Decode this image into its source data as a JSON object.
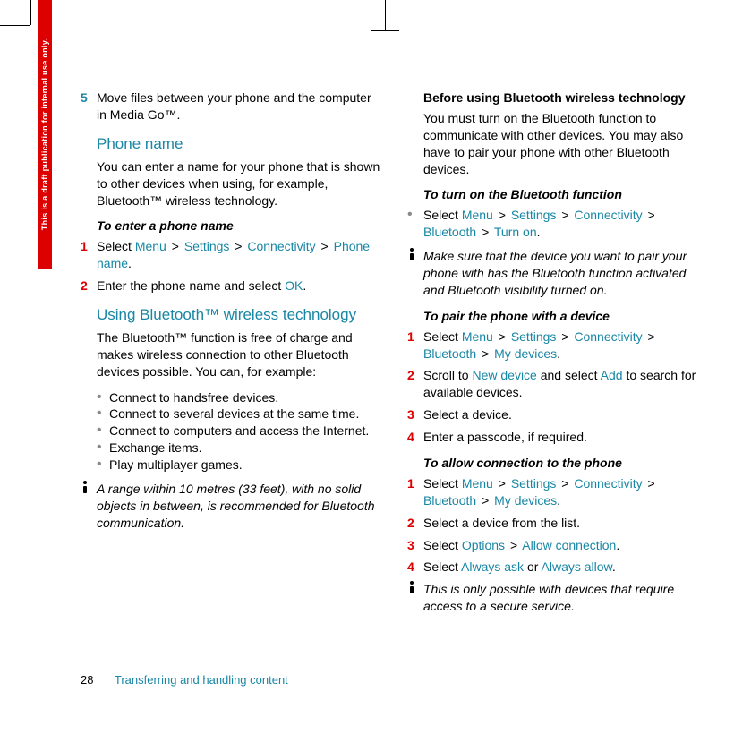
{
  "side_label": "This is a draft publication for internal use only.",
  "col1": {
    "step5_num": "5",
    "step5_text": "Move files between your phone and the computer in Media Go™.",
    "h_phone_name": "Phone name",
    "p_phone_name": "You can enter a name for your phone that is shown to other devices when using, for example, Bluetooth™ wireless technology.",
    "h_enter_name": "To enter a phone name",
    "enter_s1_num": "1",
    "enter_s1_pre": "Select ",
    "enter_s1_menu": "Menu",
    "enter_s1_settings": "Settings",
    "enter_s1_conn": "Connectivity",
    "enter_s1_phone_name": "Phone name",
    "enter_s2_num": "2",
    "enter_s2_pre": "Enter the phone name and select ",
    "enter_s2_ok": "OK",
    "h_bt": "Using Bluetooth™ wireless technology",
    "p_bt": "The Bluetooth™ function is free of charge and makes wireless connection to other Bluetooth devices possible. You can, for example:",
    "b1": "Connect to handsfree devices.",
    "b2": "Connect to several devices at the same time.",
    "b3": "Connect to computers and access the Internet.",
    "b4": "Exchange items.",
    "b5": "Play multiplayer games.",
    "note1": "A range within 10 metres (33 feet), with no solid objects in between, is recommended for Bluetooth communication."
  },
  "col2": {
    "h_before": "Before using Bluetooth wireless technology",
    "p_before": "You must turn on the Bluetooth function to communicate with other devices. You may also have to pair your phone with other Bluetooth devices.",
    "h_turn_on": "To turn on the Bluetooth function",
    "turn_pre": "Select ",
    "turn_menu": "Menu",
    "turn_settings": "Settings",
    "turn_conn": "Connectivity",
    "turn_bt": "Bluetooth",
    "turn_on": "Turn on",
    "note2": "Make sure that the device you want to pair your phone with has the Bluetooth function activated and Bluetooth visibility turned on.",
    "h_pair": "To pair the phone with a device",
    "pair1_num": "1",
    "pair1_pre": "Select ",
    "pair1_menu": "Menu",
    "pair1_settings": "Settings",
    "pair1_conn": "Connectivity",
    "pair1_bt": "Bluetooth",
    "pair1_my": "My devices",
    "pair2_num": "2",
    "pair2_a": "Scroll to ",
    "pair2_new": "New device",
    "pair2_b": " and select ",
    "pair2_add": "Add",
    "pair2_c": " to search for available devices.",
    "pair3_num": "3",
    "pair3": "Select a device.",
    "pair4_num": "4",
    "pair4": "Enter a passcode, if required.",
    "h_allow": "To allow connection to the phone",
    "allow1_num": "1",
    "allow1_pre": "Select ",
    "allow1_menu": "Menu",
    "allow1_settings": "Settings",
    "allow1_conn": "Connectivity",
    "allow1_bt": "Bluetooth",
    "allow1_my": "My devices",
    "allow2_num": "2",
    "allow2": "Select a device from the list.",
    "allow3_num": "3",
    "allow3_pre": "Select ",
    "allow3_opt": "Options",
    "allow3_ac": "Allow connection",
    "allow4_num": "4",
    "allow4_pre": "Select ",
    "allow4_ask": "Always ask",
    "allow4_or": " or ",
    "allow4_allow": "Always allow",
    "note3": "This is only possible with devices that require access to a secure service."
  },
  "footer": {
    "page": "28",
    "section": "Transferring and handling content"
  },
  "gt": ">",
  "dot": "•",
  "period": "."
}
